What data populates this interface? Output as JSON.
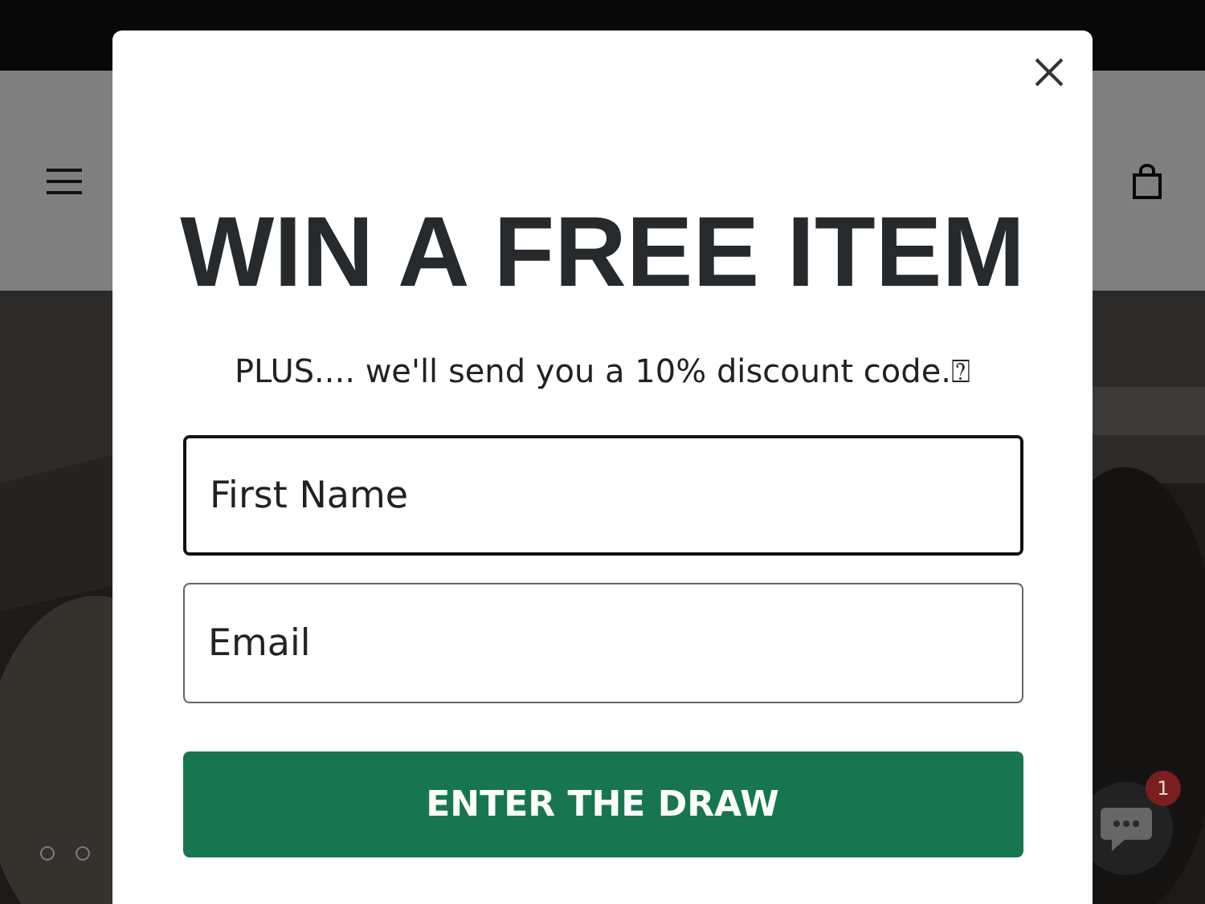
{
  "popup": {
    "title": "WIN A FREE ITEM",
    "subtitle": "PLUS.... we'll send you a 10% discount code.⍰",
    "fields": [
      {
        "placeholder": "First Name",
        "focused": true
      },
      {
        "placeholder": "Email",
        "focused": false
      }
    ],
    "button": "ENTER THE DRAW"
  },
  "slider_dots": [
    {
      "selected": false
    },
    {
      "selected": false
    }
  ],
  "chat": {
    "badge": "1"
  }
}
